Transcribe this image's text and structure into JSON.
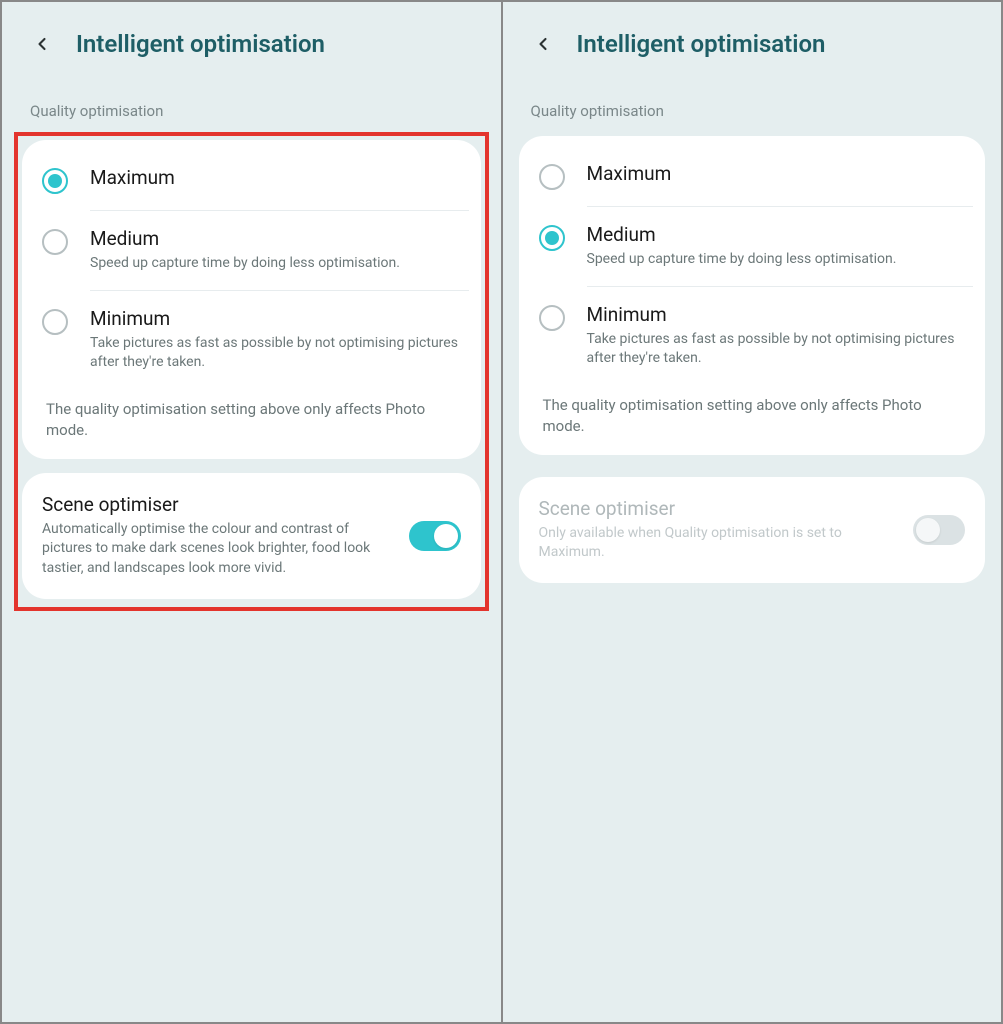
{
  "left": {
    "title": "Intelligent optimisation",
    "sectionLabel": "Quality optimisation",
    "options": [
      {
        "title": "Maximum",
        "desc": "",
        "selected": true
      },
      {
        "title": "Medium",
        "desc": "Speed up capture time by doing less optimisation.",
        "selected": false
      },
      {
        "title": "Minimum",
        "desc": "Take pictures as fast as possible by not optimising pictures after they're taken.",
        "selected": false
      }
    ],
    "note": "The quality optimisation setting above only affects Photo mode.",
    "scene": {
      "title": "Scene optimiser",
      "desc": "Automatically optimise the colour and contrast of pictures to make dark scenes look brighter, food look tastier, and landscapes look more vivid.",
      "enabled": true,
      "on": true
    },
    "highlight": true
  },
  "right": {
    "title": "Intelligent optimisation",
    "sectionLabel": "Quality optimisation",
    "options": [
      {
        "title": "Maximum",
        "desc": "",
        "selected": false
      },
      {
        "title": "Medium",
        "desc": "Speed up capture time by doing less optimisation.",
        "selected": true
      },
      {
        "title": "Minimum",
        "desc": "Take pictures as fast as possible by not optimising pictures after they're taken.",
        "selected": false
      }
    ],
    "note": "The quality optimisation setting above only affects Photo mode.",
    "scene": {
      "title": "Scene optimiser",
      "desc": "Only available when Quality optimisation is set to Maximum.",
      "enabled": false,
      "on": false
    },
    "highlight": false
  }
}
